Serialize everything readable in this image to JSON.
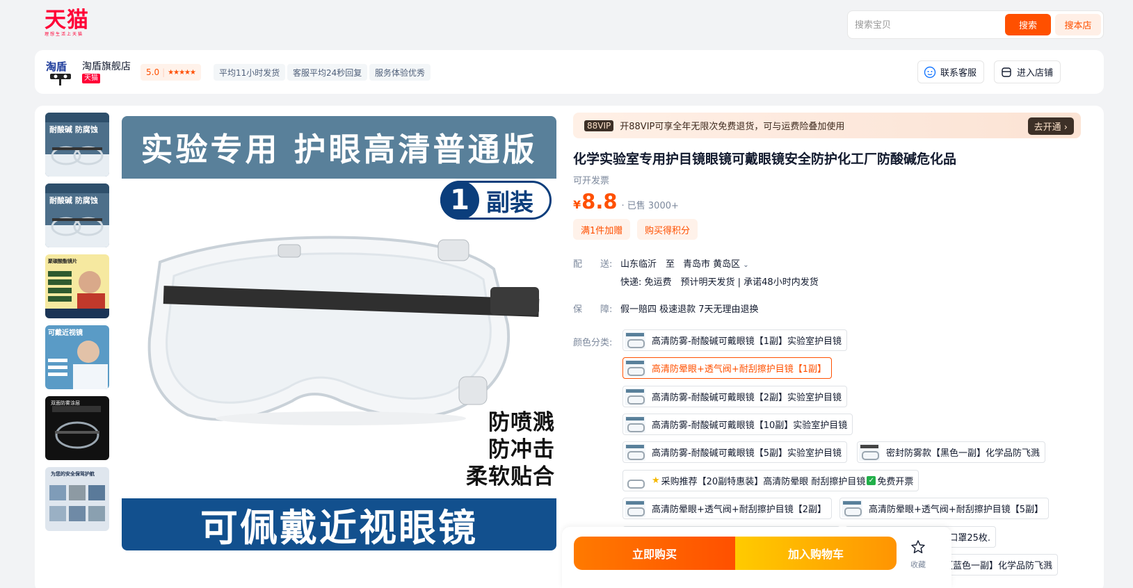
{
  "header": {
    "logo_text": "天猫",
    "logo_slogan": "理想生活上天猫",
    "search_placeholder": "搜索宝贝",
    "search_button": "搜索",
    "search_store_button": "搜本店"
  },
  "shop": {
    "name": "淘盾旗舰店",
    "tag": "天猫",
    "rating": "5.0",
    "rating_stars": "★★★★★",
    "chips": [
      "平均11小时发货",
      "客服平均24秒回复",
      "服务体验优秀"
    ],
    "contact_button": "联系客服",
    "enter_store_button": "进入店铺"
  },
  "gallery": {
    "main": {
      "top_banner": "实验专用 护眼高清普通版",
      "badge_number": "1",
      "badge_text": "副装",
      "features": [
        "防喷溅",
        "防冲击",
        "柔软贴合"
      ],
      "bottom_banner": "可佩戴近视眼镜"
    },
    "thumbs": [
      {
        "caption": "耐酸碱 防腐蚀"
      },
      {
        "caption": "耐酸碱 防腐蚀"
      },
      {
        "caption": "聚碳酸酯镜片"
      },
      {
        "caption": "可戴近视镜"
      },
      {
        "caption": "双面防雾涂层"
      },
      {
        "caption": "为您的安全保驾护航"
      }
    ]
  },
  "product": {
    "vip_tag": "88VIP",
    "vip_text": "开88VIP可享全年无限次免费退货，可与运费险叠加使用",
    "vip_button": "去开通 ›",
    "title": "化学实验室专用护目镜眼镜可戴眼镜安全防护化工厂防酸碱危化品",
    "invoice": "可开发票",
    "price_symbol": "¥",
    "price": "8.8",
    "sold": "· 已售 3000+",
    "promos": [
      "满1件加赠",
      "购买得积分"
    ]
  },
  "delivery": {
    "label": "配　　送:",
    "from": "山东临沂",
    "to_word": "至",
    "to": "青岛市 黄岛区",
    "detail": "快递: 免运费　预计明天发货 | 承诺48小时内发货"
  },
  "guarantee": {
    "label": "保　　障:",
    "value": "假一赔四 极速退款 7天无理由退换"
  },
  "sku": {
    "label": "颜色分类:",
    "options": [
      "高清防雾-耐酸碱可戴眼镜【1副】实验室护目镜",
      "高清防晕眼+透气阀+耐刮擦护目镜【1副】",
      "高清防雾-耐酸碱可戴眼镜【2副】实验室护目镜",
      "高清防雾-耐酸碱可戴眼镜【10副】实验室护目镜",
      "高清防雾-耐酸碱可戴眼镜【5副】实验室护目镜",
      "密封防雾款【黑色一副】化学品防飞溅",
      "采购推荐【20副特惠装】高清防晕眼 耐刮擦护目镜",
      "免费开票",
      "高清防晕眼+透气阀+耐刮擦护目镜【2副】",
      "高清防晕眼+透气阀+耐刮擦护目镜【5副】",
      "用口罩25枚.",
      "【蓝色一副】化学品防飞溅"
    ]
  },
  "actions": {
    "buy_now": "立即购买",
    "add_to_cart": "加入购物车",
    "favorite": "收藏"
  },
  "colors": {
    "brand": "#ff0036",
    "accent": "#ff5000",
    "cart": "#ffb300"
  }
}
